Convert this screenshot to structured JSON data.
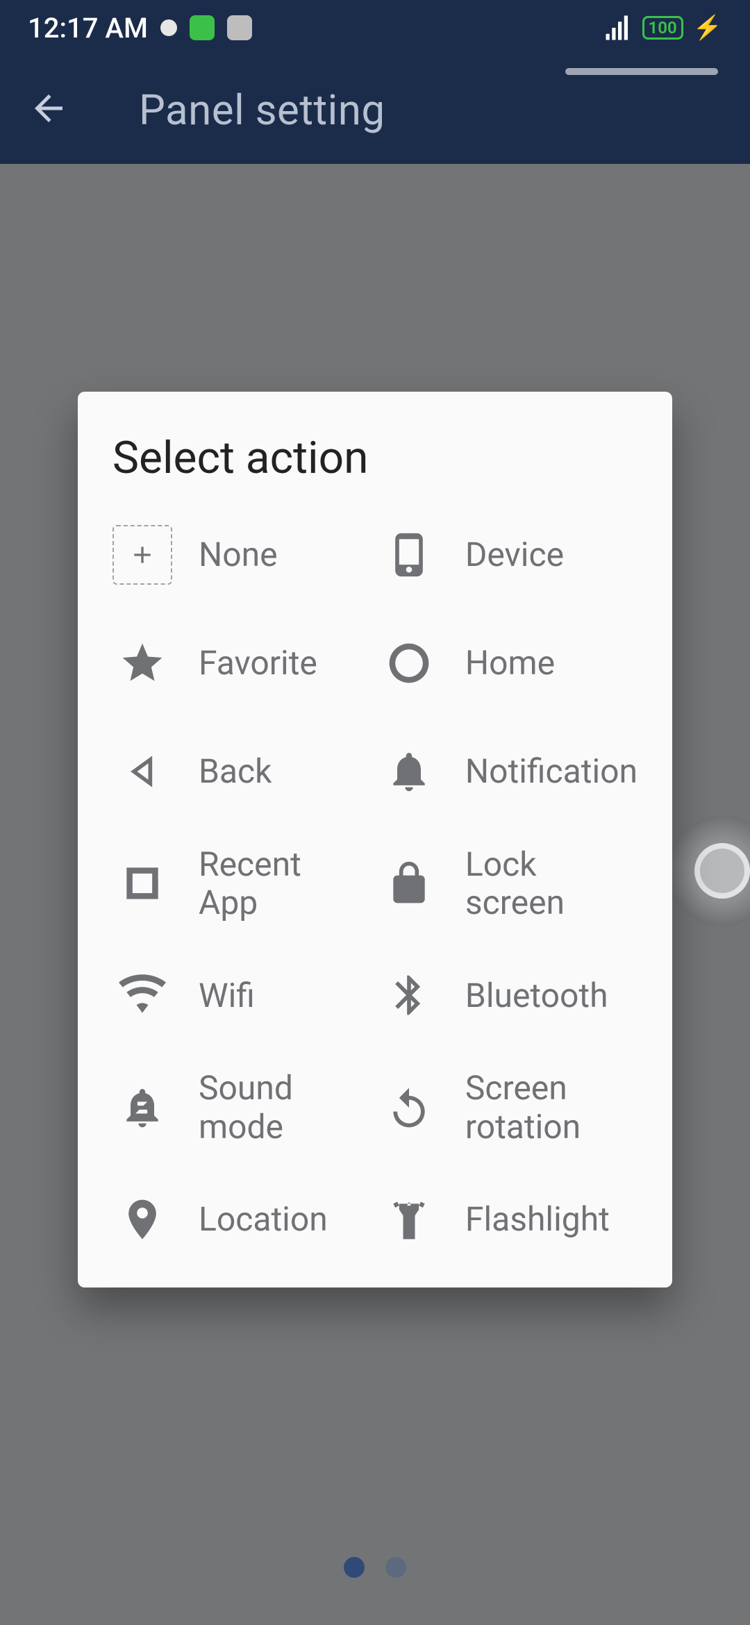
{
  "status": {
    "time": "12:17 AM",
    "battery_percent": "100"
  },
  "app_bar": {
    "title": "Panel setting"
  },
  "dialog": {
    "title": "Select action",
    "actions": [
      {
        "id": "none",
        "label": "None",
        "icon": "plus-dashed-icon"
      },
      {
        "id": "device",
        "label": "Device",
        "icon": "phone-icon"
      },
      {
        "id": "favorite",
        "label": "Favorite",
        "icon": "star-icon"
      },
      {
        "id": "home",
        "label": "Home",
        "icon": "circle-icon"
      },
      {
        "id": "back",
        "label": "Back",
        "icon": "nav-back-icon"
      },
      {
        "id": "notification",
        "label": "Notification",
        "icon": "bell-icon"
      },
      {
        "id": "recent-app",
        "label": "Recent App",
        "icon": "square-icon"
      },
      {
        "id": "lock-screen",
        "label": "Lock screen",
        "icon": "lock-icon"
      },
      {
        "id": "wifi",
        "label": "Wifi",
        "icon": "wifi-icon"
      },
      {
        "id": "bluetooth",
        "label": "Bluetooth",
        "icon": "bluetooth-icon"
      },
      {
        "id": "sound-mode",
        "label": "Sound mode",
        "icon": "bell-snooze-icon"
      },
      {
        "id": "screen-rotation",
        "label": "Screen rotation",
        "icon": "rotate-icon"
      },
      {
        "id": "location",
        "label": "Location",
        "icon": "pin-icon"
      },
      {
        "id": "flashlight",
        "label": "Flashlight",
        "icon": "flashlight-icon"
      }
    ]
  },
  "pager": {
    "count": 2,
    "active_index": 0
  }
}
